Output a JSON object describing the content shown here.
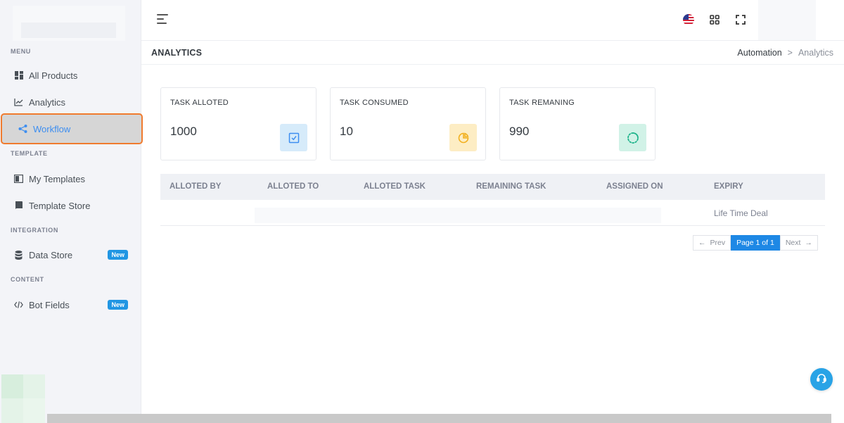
{
  "sidebar": {
    "sections": {
      "menu": "MENU",
      "template": "TEMPLATE",
      "integration": "INTEGRATION",
      "content": "CONTENT"
    },
    "items": {
      "all_products": "All Products",
      "analytics": "Analytics",
      "workflow": "Workflow",
      "my_templates": "My Templates",
      "template_store": "Template Store",
      "data_store": "Data Store",
      "bot_fields": "Bot Fields"
    },
    "badges": {
      "data_store": "New",
      "bot_fields": "New"
    }
  },
  "page": {
    "title": "ANALYTICS",
    "breadcrumb": {
      "parent": "Automation",
      "separator": ">",
      "current": "Analytics"
    }
  },
  "cards": [
    {
      "label": "TASK ALLOTED",
      "value": "1000",
      "icon": "check-square-icon",
      "color": "#d6ebfa"
    },
    {
      "label": "TASK CONSUMED",
      "value": "10",
      "icon": "pie-chart-icon",
      "color": "#fdedc4"
    },
    {
      "label": "TASK REMANING",
      "value": "990",
      "icon": "loader-circle-icon",
      "color": "#d1f2e7"
    }
  ],
  "table": {
    "headers": [
      "ALLOTED BY",
      "ALLOTED TO",
      "ALLOTED TASK",
      "REMAINING TASK",
      "ASSIGNED ON",
      "EXPIRY"
    ],
    "rows": [
      {
        "expiry": "Life Time Deal"
      }
    ]
  },
  "pagination": {
    "prev": "Prev",
    "current": "Page 1 of 1",
    "next": "Next",
    "prev_arrow": "←",
    "next_arrow": "→"
  },
  "colors": {
    "accent": "#3d8ef0",
    "highlight_border": "#f07b2e",
    "badge": "#2196e3",
    "help_button": "#29a3e6"
  }
}
